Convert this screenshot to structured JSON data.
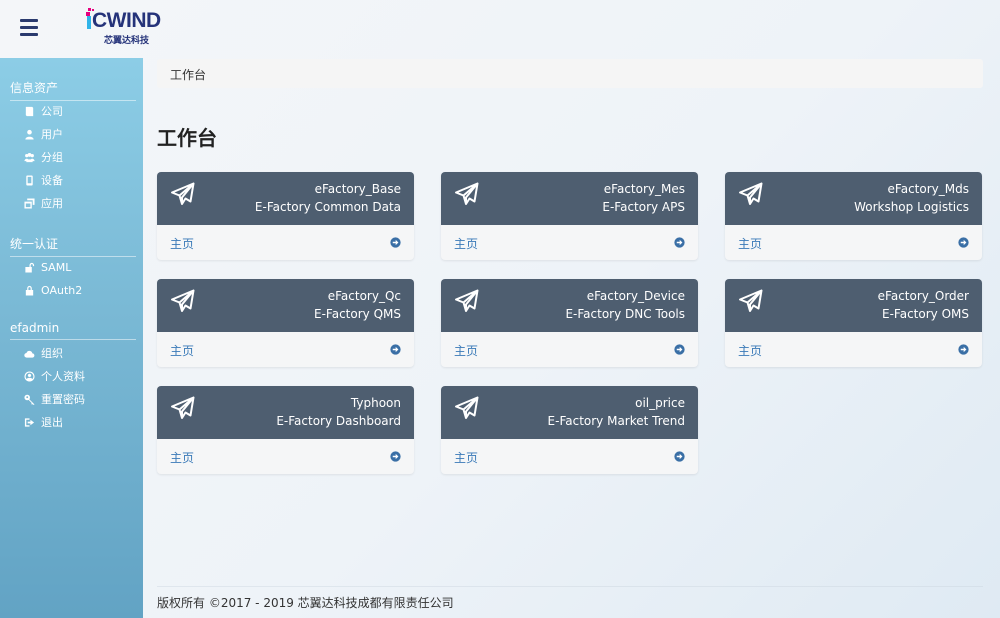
{
  "header": {
    "logo_text": "CWIND",
    "logo_subtitle": "芯翼达科技"
  },
  "sidebar": {
    "sections": [
      {
        "title": "信息资产",
        "items": [
          {
            "label": "公司",
            "icon": "book-icon"
          },
          {
            "label": "用户",
            "icon": "user-icon"
          },
          {
            "label": "分组",
            "icon": "users-icon"
          },
          {
            "label": "设备",
            "icon": "mobile-icon"
          },
          {
            "label": "应用",
            "icon": "window-restore-icon"
          }
        ]
      },
      {
        "title": "统一认证",
        "items": [
          {
            "label": "SAML",
            "icon": "unlock-icon"
          },
          {
            "label": "OAuth2",
            "icon": "lock-icon"
          }
        ]
      },
      {
        "title": "efadmin",
        "items": [
          {
            "label": "组织",
            "icon": "cloud-icon"
          },
          {
            "label": "个人资料",
            "icon": "user-circle-icon"
          },
          {
            "label": "重置密码",
            "icon": "key-icon"
          },
          {
            "label": "退出",
            "icon": "sign-out-icon"
          }
        ]
      }
    ]
  },
  "breadcrumb": {
    "current": "工作台"
  },
  "page": {
    "title": "工作台"
  },
  "cards": [
    {
      "name": "eFactory_Base",
      "desc": "E-Factory Common Data",
      "link": "主页"
    },
    {
      "name": "eFactory_Mes",
      "desc": "E-Factory APS",
      "link": "主页"
    },
    {
      "name": "eFactory_Mds",
      "desc": "Workshop Logistics",
      "link": "主页"
    },
    {
      "name": "eFactory_Qc",
      "desc": "E-Factory QMS",
      "link": "主页"
    },
    {
      "name": "eFactory_Device",
      "desc": "E-Factory DNC Tools",
      "link": "主页"
    },
    {
      "name": "eFactory_Order",
      "desc": "E-Factory OMS",
      "link": "主页"
    },
    {
      "name": "Typhoon",
      "desc": "E-Factory Dashboard",
      "link": "主页"
    },
    {
      "name": "oil_price",
      "desc": "E-Factory Market Trend",
      "link": "主页"
    }
  ],
  "footer": {
    "text": "版权所有 ©2017 - 2019 芯翼达科技成都有限责任公司"
  },
  "colors": {
    "card_header": "#4e5e70",
    "link": "#3a7ab8",
    "logo": "#25337a",
    "sidebar_top": "#8ccde6",
    "sidebar_bottom": "#62a3c4"
  }
}
